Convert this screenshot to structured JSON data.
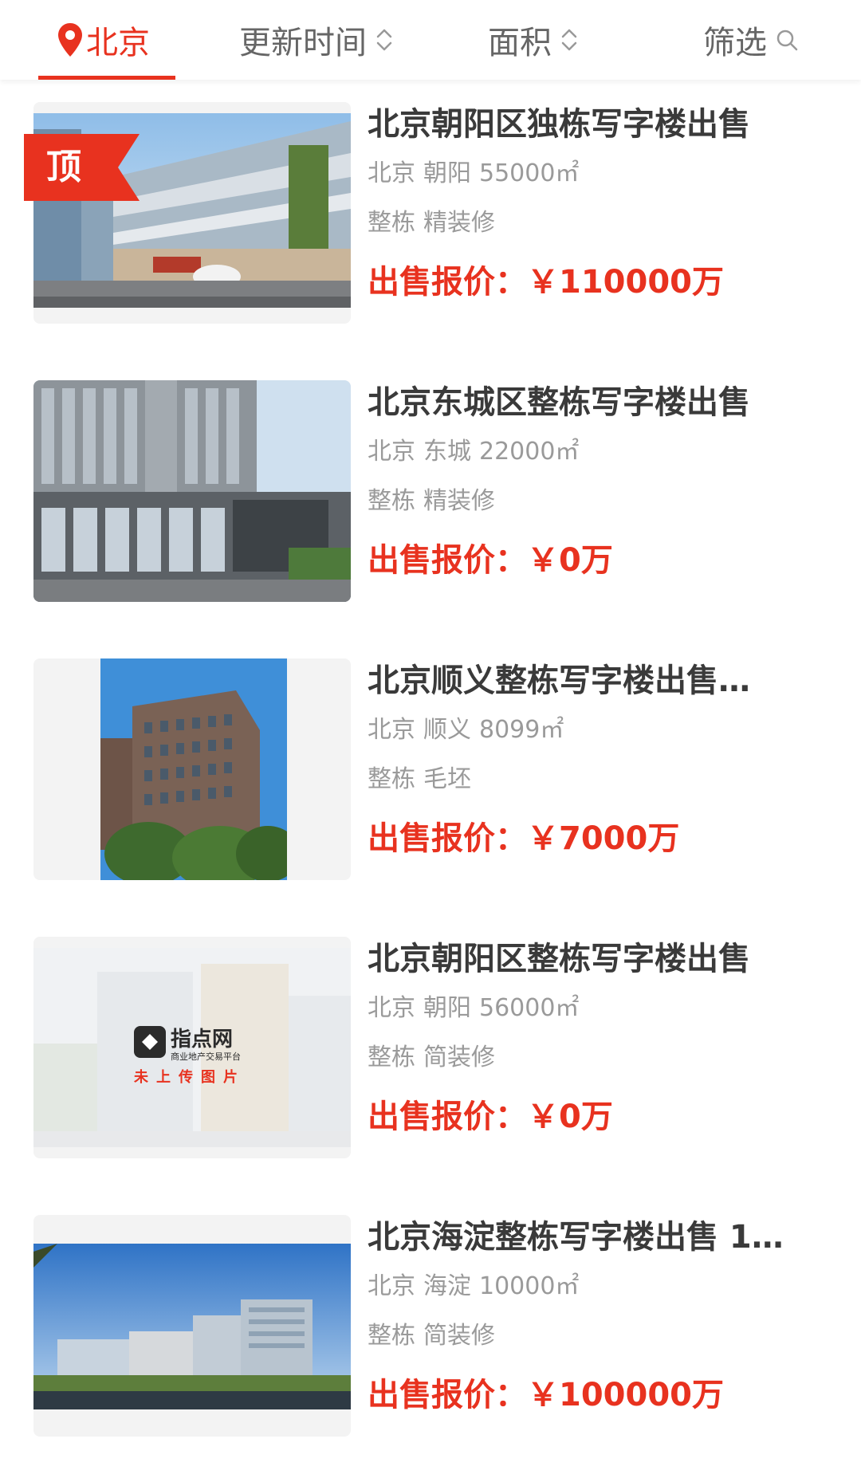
{
  "filter_bar": {
    "city": "北京",
    "update_time": "更新时间",
    "area": "面积",
    "filter": "筛选",
    "accent_color": "#e8321f"
  },
  "badge": {
    "top_label": "顶"
  },
  "listings": [
    {
      "title": "北京朝阳区独栋写字楼出售",
      "city": "北京",
      "district": "朝阳",
      "area": "55000㎡",
      "type": "整栋",
      "decoration": "精装修",
      "price": "出售报价：￥110000万"
    },
    {
      "title": "北京东城区整栋写字楼出售",
      "city": "北京",
      "district": "东城",
      "area": "22000㎡",
      "type": "整栋",
      "decoration": "精装修",
      "price": "出售报价：￥0万"
    },
    {
      "title": "北京顺义整栋写字楼出售…",
      "city": "北京",
      "district": "顺义",
      "area": "8099㎡",
      "type": "整栋",
      "decoration": "毛坯",
      "price": "出售报价：￥7000万"
    },
    {
      "title": "北京朝阳区整栋写字楼出售",
      "city": "北京",
      "district": "朝阳",
      "area": "56000㎡",
      "type": "整栋",
      "decoration": "简装修",
      "price": "出售报价：￥0万"
    },
    {
      "title": "北京海淀整栋写字楼出售 1…",
      "city": "北京",
      "district": "海淀",
      "area": "10000㎡",
      "type": "整栋",
      "decoration": "简装修",
      "price": "出售报价：￥100000万"
    }
  ],
  "placeholder": {
    "brand": "指点网",
    "slogan": "商业地产交易平台",
    "notice": "未上传图片"
  }
}
